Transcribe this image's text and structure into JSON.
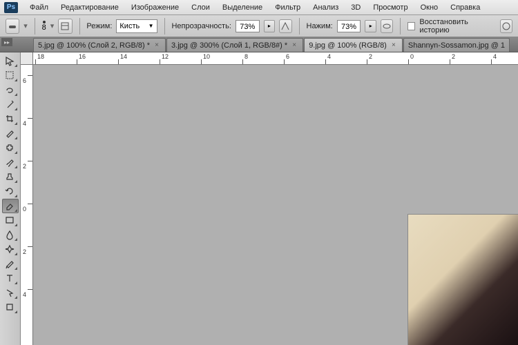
{
  "menu": {
    "items": [
      "Файл",
      "Редактирование",
      "Изображение",
      "Слои",
      "Выделение",
      "Фильтр",
      "Анализ",
      "3D",
      "Просмотр",
      "Окно",
      "Справка"
    ]
  },
  "options": {
    "mode_label": "Режим:",
    "mode_value": "Кисть",
    "opacity_label": "Непрозрачность:",
    "opacity_value": "73%",
    "flow_label": "Нажим:",
    "flow_value": "73%",
    "history_label": "Восстановить историю",
    "brush_size": "8"
  },
  "tabs": [
    {
      "label": "5.jpg @ 100% (Слой 2, RGB/8) *",
      "close": "×"
    },
    {
      "label": "3.jpg @ 300% (Слой 1, RGB/8#) *",
      "close": "×"
    },
    {
      "label": "9.jpg @ 100% (RGB/8)",
      "close": "×",
      "active": true
    },
    {
      "label": "Shannyn-Sossamon.jpg @ 1",
      "close": ""
    }
  ],
  "ruler_h": [
    "18",
    "16",
    "14",
    "12",
    "10",
    "8",
    "6",
    "4",
    "2",
    "0",
    "2",
    "4"
  ],
  "ruler_v": [
    "6",
    "4",
    "2",
    "0",
    "2",
    "4"
  ]
}
